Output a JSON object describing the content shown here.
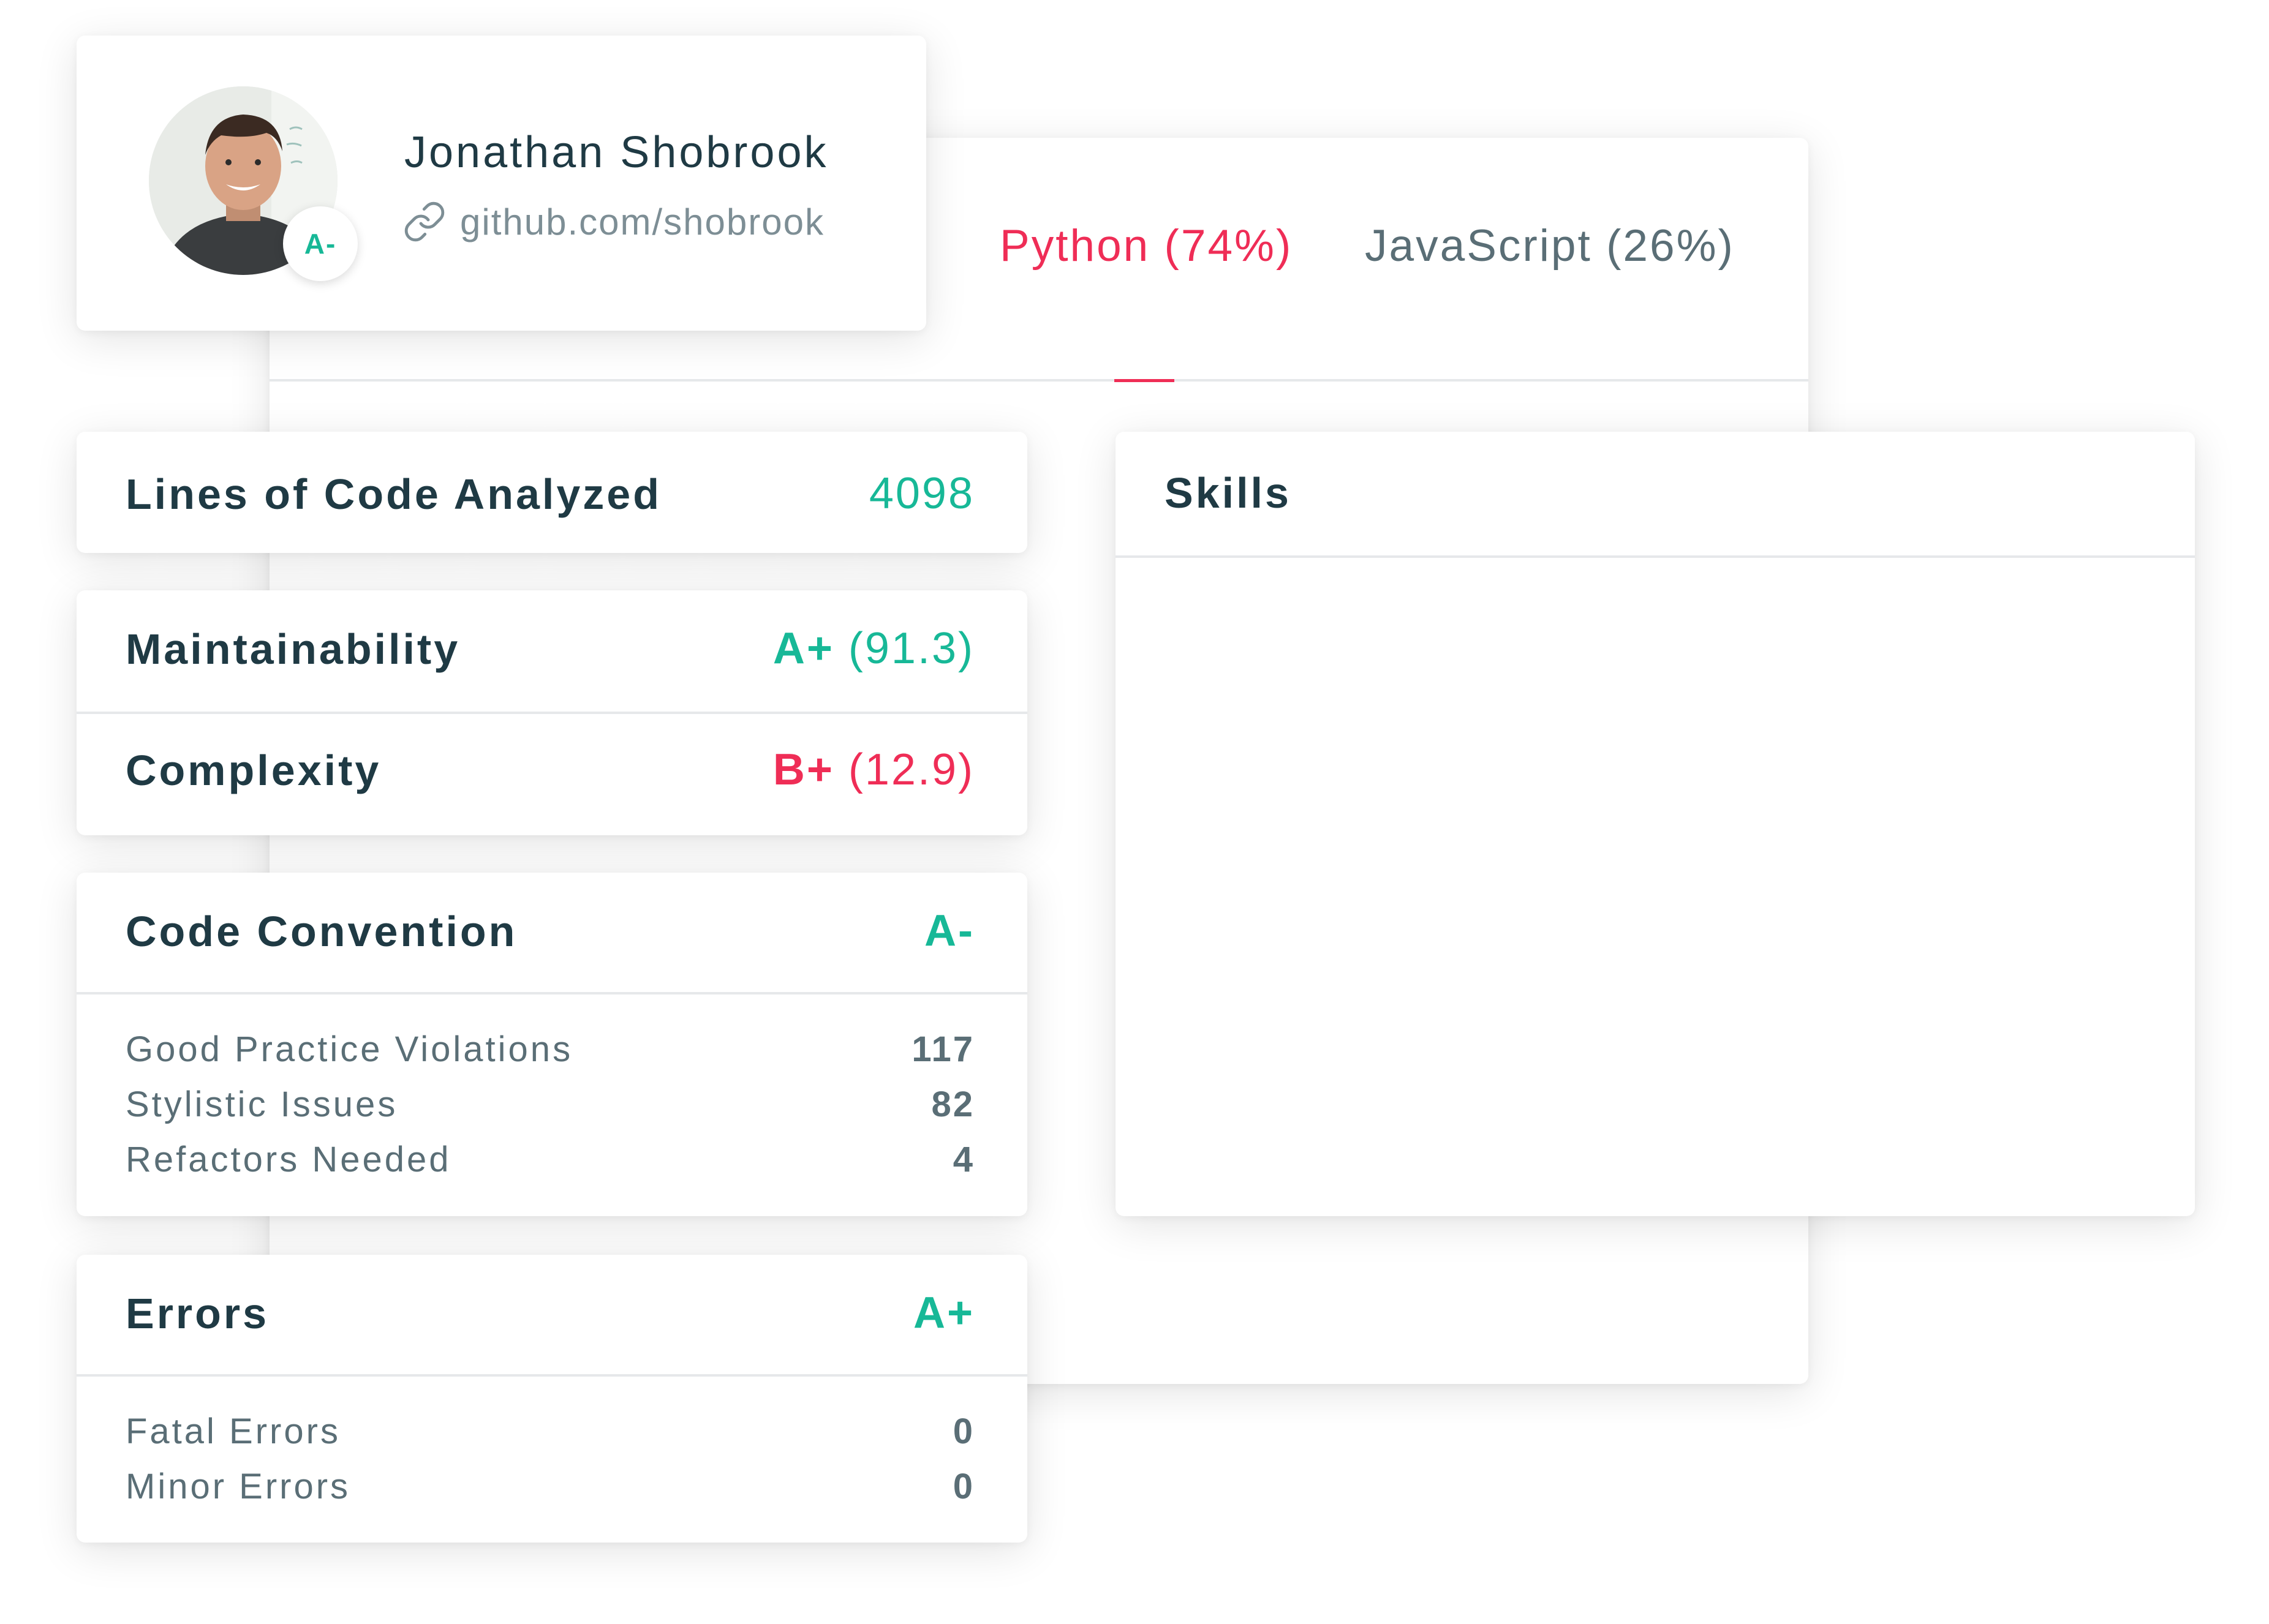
{
  "profile": {
    "name": "Jonathan Shobrook",
    "link": "github.com/shobrook",
    "grade": "A-"
  },
  "tabs": [
    {
      "label": "Python (74%)",
      "active": true
    },
    {
      "label": "JavaScript (26%)",
      "active": false
    }
  ],
  "metrics": {
    "lines_of_code": {
      "label": "Lines of Code Analyzed",
      "value": "4098"
    },
    "maintainability": {
      "label": "Maintainability",
      "grade": "A+",
      "score": "(91.3)"
    },
    "complexity": {
      "label": "Complexity",
      "grade": "B+",
      "score": "(12.9)"
    }
  },
  "code_convention": {
    "title": "Code Convention",
    "grade": "A-",
    "items": [
      {
        "label": "Good Practice Violations",
        "value": "117"
      },
      {
        "label": "Stylistic Issues",
        "value": "82"
      },
      {
        "label": "Refactors Needed",
        "value": "4"
      }
    ]
  },
  "errors": {
    "title": "Errors",
    "grade": "A+",
    "items": [
      {
        "label": "Fatal Errors",
        "value": "0"
      },
      {
        "label": "Minor Errors",
        "value": "0"
      }
    ]
  },
  "skills": {
    "title": "Skills"
  },
  "colors": {
    "accent_red": "#ef2d56",
    "accent_green": "#17b897",
    "text_dark": "#1f3a44",
    "text_muted": "#5a6e76"
  },
  "icons": {
    "link": "link-icon",
    "avatar": "avatar"
  }
}
